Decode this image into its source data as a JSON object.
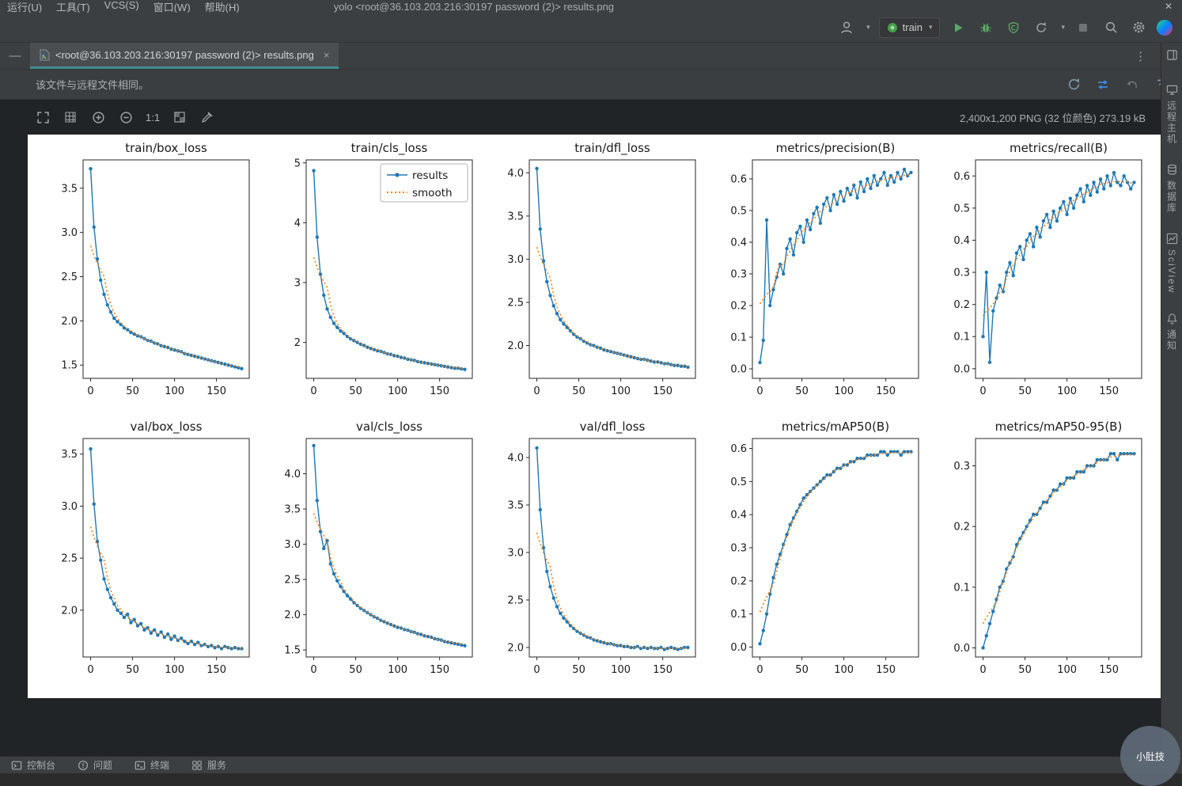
{
  "window": {
    "menu_items": [
      "运行(U)",
      "工具(T)",
      "VCS(S)",
      "窗口(W)",
      "帮助(H)"
    ],
    "title": "yolo   <root@36.103.203.216:30197 password (2)> results.png",
    "close_glyph": "✕"
  },
  "toolbar": {
    "run_config": "train"
  },
  "tab": {
    "label": "<root@36.103.203.216:30197 password (2)> results.png",
    "close_glyph": "×"
  },
  "banner": {
    "text": "该文件与远程文件相同。"
  },
  "image_toolbar": {
    "actual_size_label": "1:1",
    "info": "2,400x1,200 PNG (32 位颜色) 273.19 kB"
  },
  "right_stripe": {
    "items": [
      {
        "label": "远程主机"
      },
      {
        "label": "数据库"
      },
      {
        "label": "SciView"
      },
      {
        "label": "通知"
      }
    ]
  },
  "status_bar": {
    "items": [
      {
        "label": "控制台"
      },
      {
        "label": "问题"
      },
      {
        "label": "终端"
      },
      {
        "label": "服务"
      }
    ]
  },
  "watermark": "小肚技",
  "colors": {
    "tab_underline": "#3f8e8e",
    "run_green": "#59a869",
    "link_blue": "#3b8eea",
    "results_series": "#1f77b4",
    "smooth_series": "#ff7f0e"
  },
  "chart_data": {
    "type": "line",
    "x_step": 4,
    "x_max": 180,
    "xlim": [
      -9,
      189
    ],
    "xticks": [
      "0",
      "50",
      "100",
      "150"
    ],
    "series_style": {
      "results_color": "#1f77b4",
      "smooth_color": "#ff7f0e"
    },
    "legend": {
      "entries": [
        "results",
        "smooth"
      ],
      "position": "upper right",
      "on_plot": "train/cls_loss"
    },
    "plots": [
      {
        "title": "train/box_loss",
        "ylim": [
          1.35,
          3.82
        ],
        "yticks": [
          "1.5",
          "2.0",
          "2.5",
          "3.0",
          "3.5"
        ],
        "legend": false,
        "values": [
          3.72,
          3.06,
          2.7,
          2.46,
          2.3,
          2.18,
          2.1,
          2.03,
          1.99,
          1.96,
          1.92,
          1.9,
          1.87,
          1.85,
          1.83,
          1.82,
          1.8,
          1.78,
          1.77,
          1.75,
          1.74,
          1.72,
          1.71,
          1.7,
          1.68,
          1.67,
          1.66,
          1.65,
          1.63,
          1.62,
          1.61,
          1.6,
          1.59,
          1.58,
          1.57,
          1.56,
          1.55,
          1.54,
          1.53,
          1.52,
          1.51,
          1.5,
          1.49,
          1.48,
          1.47,
          1.46
        ]
      },
      {
        "title": "train/cls_loss",
        "ylim": [
          1.4,
          5.05
        ],
        "yticks": [
          "2",
          "3",
          "4",
          "5"
        ],
        "legend": true,
        "values": [
          4.87,
          3.76,
          3.14,
          2.79,
          2.56,
          2.42,
          2.32,
          2.25,
          2.19,
          2.15,
          2.1,
          2.06,
          2.03,
          2.0,
          1.97,
          1.95,
          1.92,
          1.9,
          1.88,
          1.86,
          1.85,
          1.83,
          1.81,
          1.8,
          1.78,
          1.77,
          1.75,
          1.74,
          1.72,
          1.71,
          1.7,
          1.68,
          1.67,
          1.66,
          1.65,
          1.64,
          1.63,
          1.62,
          1.61,
          1.6,
          1.59,
          1.58,
          1.57,
          1.57,
          1.56,
          1.55
        ]
      },
      {
        "title": "train/dfl_loss",
        "ylim": [
          1.62,
          4.15
        ],
        "yticks": [
          "2.0",
          "2.5",
          "3.0",
          "3.5",
          "4.0"
        ],
        "legend": false,
        "values": [
          4.05,
          3.35,
          2.98,
          2.74,
          2.58,
          2.46,
          2.37,
          2.3,
          2.25,
          2.21,
          2.17,
          2.13,
          2.1,
          2.08,
          2.05,
          2.03,
          2.01,
          2.0,
          1.98,
          1.97,
          1.95,
          1.94,
          1.93,
          1.92,
          1.91,
          1.9,
          1.89,
          1.88,
          1.87,
          1.86,
          1.85,
          1.84,
          1.84,
          1.83,
          1.82,
          1.81,
          1.81,
          1.8,
          1.79,
          1.79,
          1.78,
          1.77,
          1.77,
          1.76,
          1.76,
          1.75
        ]
      },
      {
        "title": "metrics/precision(B)",
        "ylim": [
          -0.03,
          0.66
        ],
        "yticks": [
          "0.0",
          "0.1",
          "0.2",
          "0.3",
          "0.4",
          "0.5",
          "0.6"
        ],
        "legend": false,
        "values": [
          0.02,
          0.09,
          0.47,
          0.2,
          0.25,
          0.29,
          0.33,
          0.3,
          0.38,
          0.41,
          0.36,
          0.43,
          0.45,
          0.4,
          0.47,
          0.44,
          0.49,
          0.51,
          0.46,
          0.52,
          0.54,
          0.5,
          0.55,
          0.52,
          0.56,
          0.53,
          0.57,
          0.55,
          0.58,
          0.54,
          0.59,
          0.56,
          0.6,
          0.57,
          0.61,
          0.58,
          0.6,
          0.62,
          0.58,
          0.61,
          0.59,
          0.62,
          0.6,
          0.63,
          0.61,
          0.62
        ]
      },
      {
        "title": "metrics/recall(B)",
        "ylim": [
          -0.03,
          0.65
        ],
        "yticks": [
          "0.0",
          "0.1",
          "0.2",
          "0.3",
          "0.4",
          "0.5",
          "0.6"
        ],
        "legend": false,
        "values": [
          0.1,
          0.3,
          0.02,
          0.18,
          0.22,
          0.26,
          0.24,
          0.3,
          0.33,
          0.29,
          0.36,
          0.38,
          0.34,
          0.4,
          0.42,
          0.38,
          0.44,
          0.41,
          0.46,
          0.48,
          0.44,
          0.49,
          0.46,
          0.5,
          0.52,
          0.48,
          0.53,
          0.5,
          0.54,
          0.56,
          0.52,
          0.57,
          0.54,
          0.58,
          0.55,
          0.59,
          0.56,
          0.6,
          0.57,
          0.61,
          0.58,
          0.57,
          0.6,
          0.58,
          0.56,
          0.58
        ]
      },
      {
        "title": "val/box_loss",
        "ylim": [
          1.55,
          3.65
        ],
        "yticks": [
          "2.0",
          "2.5",
          "3.0",
          "3.5"
        ],
        "legend": false,
        "values": [
          3.55,
          3.02,
          2.66,
          2.48,
          2.3,
          2.2,
          2.12,
          2.06,
          2.0,
          1.97,
          1.93,
          1.96,
          1.88,
          1.91,
          1.85,
          1.87,
          1.81,
          1.83,
          1.78,
          1.81,
          1.76,
          1.79,
          1.74,
          1.77,
          1.72,
          1.75,
          1.71,
          1.73,
          1.7,
          1.68,
          1.7,
          1.67,
          1.69,
          1.66,
          1.67,
          1.65,
          1.66,
          1.64,
          1.65,
          1.63,
          1.65,
          1.64,
          1.63,
          1.64,
          1.63,
          1.63
        ]
      },
      {
        "title": "val/cls_loss",
        "ylim": [
          1.4,
          4.5
        ],
        "yticks": [
          "1.5",
          "2.0",
          "2.5",
          "3.0",
          "3.5",
          "4.0"
        ],
        "legend": false,
        "values": [
          4.4,
          3.62,
          3.18,
          2.94,
          3.05,
          2.72,
          2.58,
          2.48,
          2.4,
          2.33,
          2.27,
          2.22,
          2.17,
          2.13,
          2.09,
          2.06,
          2.03,
          2.0,
          1.97,
          1.95,
          1.92,
          1.9,
          1.88,
          1.86,
          1.84,
          1.82,
          1.81,
          1.79,
          1.78,
          1.76,
          1.75,
          1.73,
          1.72,
          1.7,
          1.69,
          1.68,
          1.66,
          1.65,
          1.64,
          1.62,
          1.61,
          1.6,
          1.59,
          1.58,
          1.57,
          1.56
        ]
      },
      {
        "title": "val/dfl_loss",
        "ylim": [
          1.9,
          4.2
        ],
        "yticks": [
          "2.0",
          "2.5",
          "3.0",
          "3.5",
          "4.0"
        ],
        "legend": false,
        "values": [
          4.1,
          3.45,
          3.05,
          2.8,
          2.64,
          2.52,
          2.43,
          2.36,
          2.31,
          2.27,
          2.23,
          2.2,
          2.17,
          2.15,
          2.13,
          2.11,
          2.1,
          2.08,
          2.07,
          2.06,
          2.05,
          2.04,
          2.04,
          2.03,
          2.02,
          2.02,
          2.01,
          2.01,
          2.0,
          2.0,
          2.01,
          1.99,
          2.0,
          1.99,
          2.0,
          1.99,
          1.99,
          2.0,
          1.98,
          1.99,
          2.0,
          1.99,
          1.98,
          1.99,
          2.0,
          2.0
        ]
      },
      {
        "title": "metrics/mAP50(B)",
        "ylim": [
          -0.03,
          0.63
        ],
        "yticks": [
          "0.0",
          "0.1",
          "0.2",
          "0.3",
          "0.4",
          "0.5",
          "0.6"
        ],
        "legend": false,
        "values": [
          0.01,
          0.05,
          0.1,
          0.16,
          0.21,
          0.25,
          0.28,
          0.31,
          0.34,
          0.37,
          0.39,
          0.41,
          0.43,
          0.45,
          0.46,
          0.47,
          0.48,
          0.49,
          0.5,
          0.51,
          0.52,
          0.52,
          0.53,
          0.54,
          0.54,
          0.55,
          0.55,
          0.56,
          0.56,
          0.57,
          0.57,
          0.57,
          0.58,
          0.58,
          0.58,
          0.58,
          0.59,
          0.59,
          0.58,
          0.59,
          0.59,
          0.59,
          0.58,
          0.59,
          0.59,
          0.59
        ]
      },
      {
        "title": "metrics/mAP50-95(B)",
        "ylim": [
          -0.015,
          0.345
        ],
        "yticks": [
          "0.0",
          "0.1",
          "0.2",
          "0.3"
        ],
        "legend": false,
        "values": [
          0.0,
          0.02,
          0.04,
          0.06,
          0.08,
          0.1,
          0.11,
          0.13,
          0.14,
          0.15,
          0.17,
          0.18,
          0.19,
          0.2,
          0.21,
          0.22,
          0.22,
          0.23,
          0.24,
          0.24,
          0.25,
          0.26,
          0.26,
          0.27,
          0.27,
          0.28,
          0.28,
          0.28,
          0.29,
          0.29,
          0.29,
          0.3,
          0.3,
          0.3,
          0.31,
          0.31,
          0.31,
          0.31,
          0.32,
          0.32,
          0.31,
          0.32,
          0.32,
          0.32,
          0.32,
          0.32
        ]
      }
    ]
  }
}
